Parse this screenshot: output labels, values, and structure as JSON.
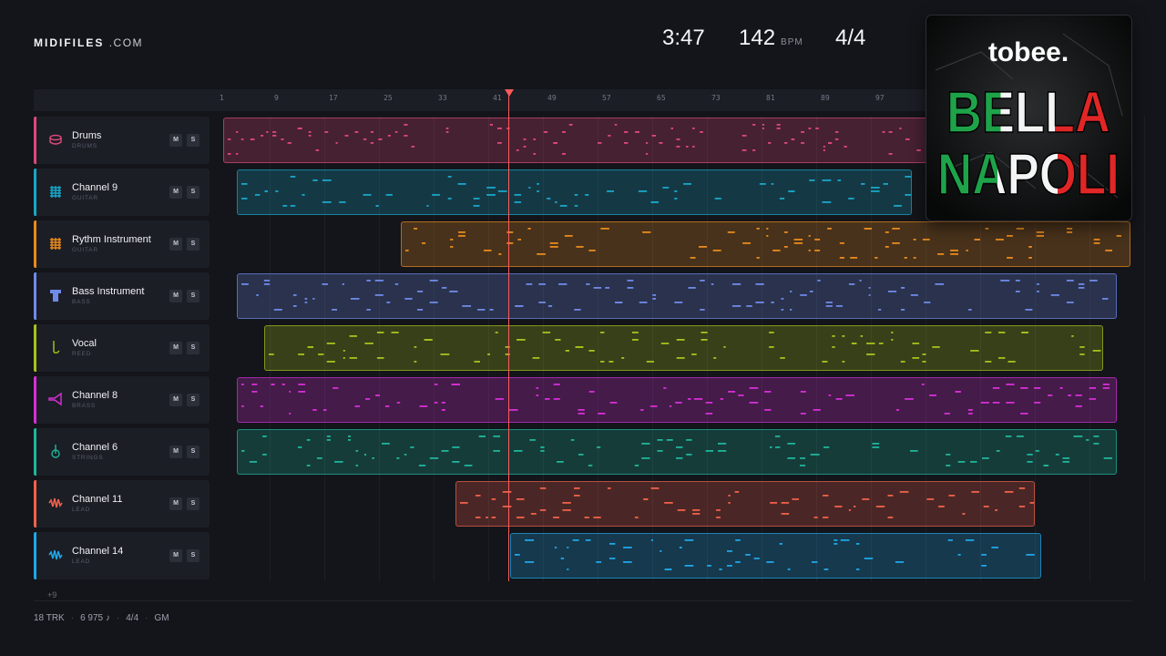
{
  "brand": {
    "name": "MIDIFILES",
    "suffix": ".COM"
  },
  "transport": {
    "time": "3:47",
    "bpm": "142",
    "bpm_unit": "BPM",
    "meter": "4/4"
  },
  "ruler": {
    "ticks": [
      "1",
      "9",
      "17",
      "25",
      "33",
      "41",
      "49",
      "57",
      "65",
      "73",
      "81",
      "89",
      "97"
    ]
  },
  "playhead_bar": 41,
  "tracks": [
    {
      "name": "Drums",
      "type": "DRUMS",
      "icon": "drum-icon",
      "color": "#e0487a",
      "m": "M",
      "s": "S"
    },
    {
      "name": "Channel 9",
      "type": "GUITAR",
      "icon": "guitar-icon",
      "color": "#19a6c8",
      "m": "M",
      "s": "S"
    },
    {
      "name": "Rythm Instrument",
      "type": "GUITAR",
      "icon": "guitar-icon",
      "color": "#e88a1e",
      "m": "M",
      "s": "S"
    },
    {
      "name": "Bass Instrument",
      "type": "BASS",
      "icon": "bass-icon",
      "color": "#6f8ae8",
      "m": "M",
      "s": "S"
    },
    {
      "name": "Vocal",
      "type": "REED",
      "icon": "reed-icon",
      "color": "#a6c21c",
      "m": "M",
      "s": "S"
    },
    {
      "name": "Channel 8",
      "type": "BRASS",
      "icon": "brass-icon",
      "color": "#d62fd6",
      "m": "M",
      "s": "S"
    },
    {
      "name": "Channel 6",
      "type": "STRINGS",
      "icon": "strings-icon",
      "color": "#1fb59a",
      "m": "M",
      "s": "S"
    },
    {
      "name": "Channel 11",
      "type": "LEAD",
      "icon": "waveform-icon",
      "color": "#f0614a",
      "m": "M",
      "s": "S"
    },
    {
      "name": "Channel 14",
      "type": "LEAD",
      "icon": "waveform-icon",
      "color": "#1fa6e8",
      "m": "M",
      "s": "S"
    }
  ],
  "more_tracks": "+9",
  "footer": {
    "tracks": "18 TRK",
    "notes": "6 975 ♪",
    "meter": "4/4",
    "mode": "GM"
  },
  "cover": {
    "artist": "tobee.",
    "title_line1": "BELLA",
    "title_line2": "NAPOLI"
  }
}
